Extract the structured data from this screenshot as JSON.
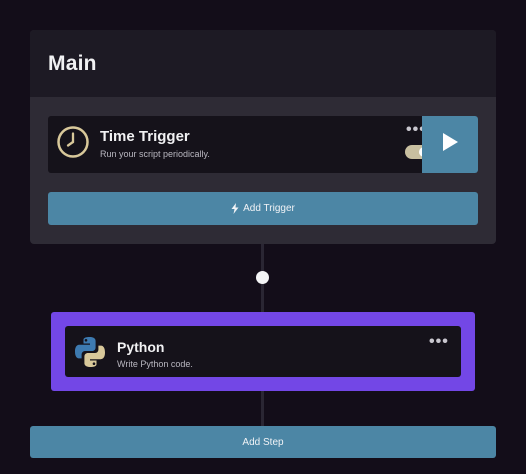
{
  "main": {
    "title": "Main",
    "trigger": {
      "title": "Time Trigger",
      "description": "Run your script periodically.",
      "menu_glyph": "•••",
      "enabled": true,
      "icon": "clock-icon"
    },
    "add_trigger_label": "Add Trigger"
  },
  "steps": [
    {
      "title": "Python",
      "description": "Write Python code.",
      "menu_glyph": "•••",
      "icon": "python-logo-icon"
    }
  ],
  "add_step_label": "Add Step",
  "colors": {
    "background": "#130d19",
    "panel": "#2e2b35",
    "panel_header": "#1d1a24",
    "card": "#15121a",
    "accent_blue": "#4c86a5",
    "step_highlight": "#7347e6",
    "toggle_on": "#c8bfa0",
    "clock": "#d8c89a"
  }
}
